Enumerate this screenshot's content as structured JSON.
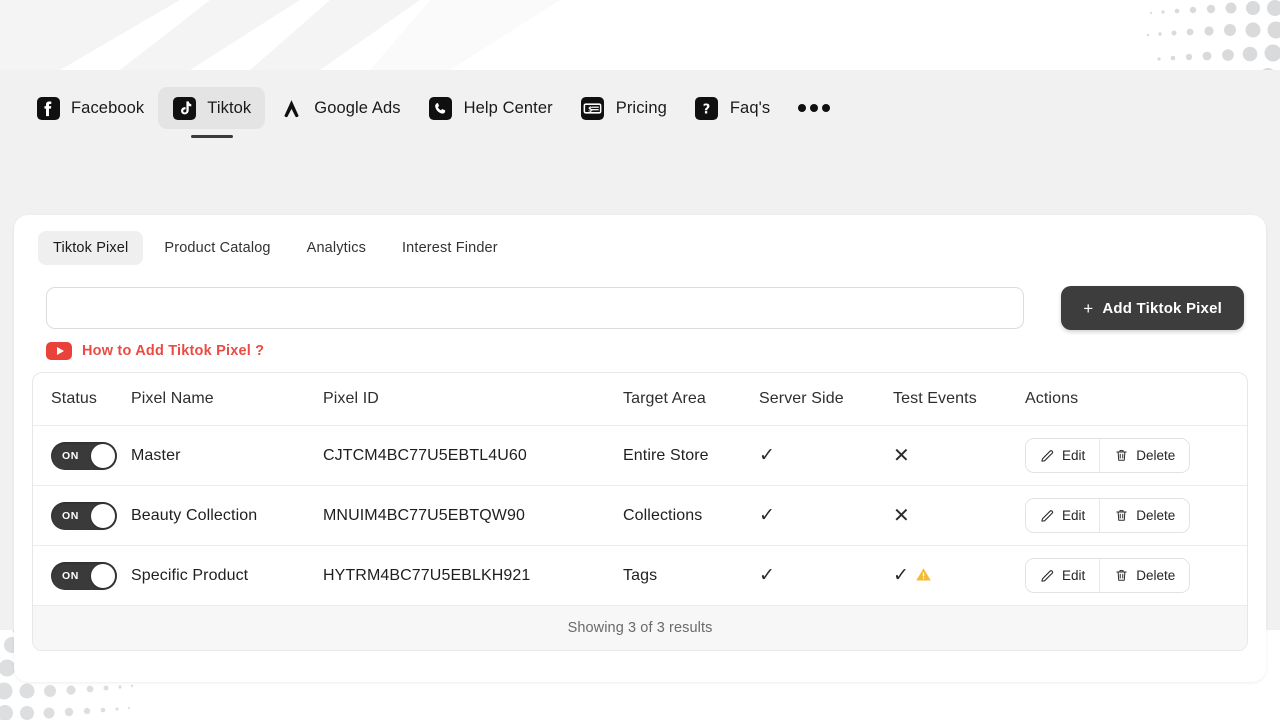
{
  "topnav": {
    "items": [
      {
        "label": "Facebook",
        "icon": "facebook-icon",
        "active": false
      },
      {
        "label": "Tiktok",
        "icon": "tiktok-icon",
        "active": true
      },
      {
        "label": "Google Ads",
        "icon": "google-ads-icon",
        "active": false
      },
      {
        "label": "Help Center",
        "icon": "phone-icon",
        "active": false
      },
      {
        "label": "Pricing",
        "icon": "money-icon",
        "active": false
      },
      {
        "label": "Faq's",
        "icon": "question-icon",
        "active": false
      }
    ],
    "more_icon": "ellipsis-icon"
  },
  "subtabs": [
    {
      "label": "Tiktok Pixel",
      "active": true
    },
    {
      "label": "Product Catalog",
      "active": false
    },
    {
      "label": "Analytics",
      "active": false
    },
    {
      "label": "Interest Finder",
      "active": false
    }
  ],
  "search": {
    "value": "",
    "placeholder": ""
  },
  "add_button": {
    "label": "Add Tiktok Pixel",
    "plus": "+"
  },
  "help_link": {
    "label": "How to Add Tiktok Pixel ?",
    "icon": "youtube-play-icon",
    "color": "#ec4b43"
  },
  "table": {
    "columns": [
      "Status",
      "Pixel Name",
      "Pixel ID",
      "Target Area",
      "Server Side",
      "Test Events",
      "Actions"
    ],
    "rows": [
      {
        "status": "ON",
        "name": "Master",
        "pixel_id": "CJTCM4BC77U5EBTL4U60",
        "target_area": "Entire Store",
        "server_side": "check",
        "test_events": "cross",
        "test_events_warning": false,
        "edit_label": "Edit",
        "delete_label": "Delete"
      },
      {
        "status": "ON",
        "name": "Beauty Collection",
        "pixel_id": "MNUIM4BC77U5EBTQW90",
        "target_area": "Collections",
        "server_side": "check",
        "test_events": "cross",
        "test_events_warning": false,
        "edit_label": "Edit",
        "delete_label": "Delete"
      },
      {
        "status": "ON",
        "name": "Specific Product",
        "pixel_id": "HYTRM4BC77U5EBLKH921",
        "target_area": "Tags",
        "server_side": "check",
        "test_events": "check",
        "test_events_warning": true,
        "edit_label": "Edit",
        "delete_label": "Delete"
      }
    ],
    "footer": "Showing 3 of 3 results"
  },
  "glyphs": {
    "check": "✓",
    "cross": "✕",
    "warning": "⚠"
  },
  "colors": {
    "page_bg": "#f1f1f1",
    "card_bg": "#ffffff",
    "accent_dark": "#3d3d3d",
    "link_red": "#ec4b43",
    "warning_amber": "#f5b battle"
  }
}
